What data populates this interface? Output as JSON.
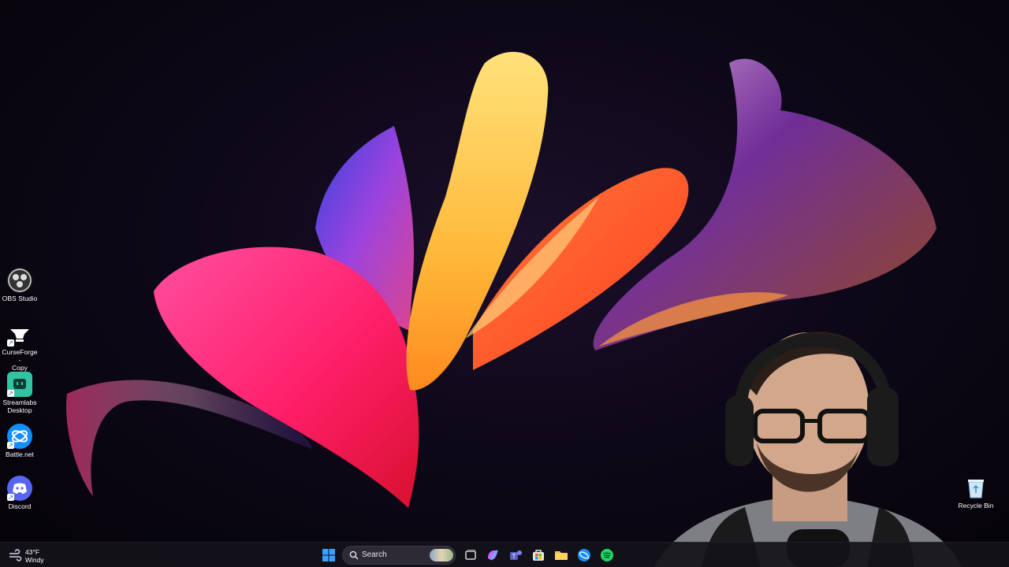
{
  "desktop": {
    "icons": [
      {
        "label_line1": "OBS Studio",
        "label_line2": "",
        "icon": "obs-icon",
        "color": "#2b2b2b"
      },
      {
        "label_line1": "CurseForge -",
        "label_line2": "Copy",
        "icon": "curseforge-icon",
        "color": "#1c1c1c"
      },
      {
        "label_line1": "Streamlabs",
        "label_line2": "Desktop",
        "icon": "streamlabs-icon",
        "color": "#31c3a2"
      },
      {
        "label_line1": "Battle.net",
        "label_line2": "",
        "icon": "battlenet-icon",
        "color": "#148eff"
      },
      {
        "label_line1": "Discord",
        "label_line2": "",
        "icon": "discord-icon",
        "color": "#5865f2"
      }
    ],
    "recycle_bin": {
      "label": "Recycle Bin",
      "icon": "recycle-bin-icon"
    }
  },
  "taskbar": {
    "weather": {
      "temp": "43°F",
      "condition": "Windy",
      "icon": "wind-icon"
    },
    "start_icon": "windows-start-icon",
    "search": {
      "label": "Search",
      "icon": "search-icon"
    },
    "pinned": [
      {
        "name": "task-view-icon",
        "color": "#d9d9d9"
      },
      {
        "name": "copilot-icon",
        "color": "#c46bff"
      },
      {
        "name": "teams-icon",
        "color": "#7b83eb"
      },
      {
        "name": "store-icon",
        "color": "#e8e8e8"
      },
      {
        "name": "file-explorer-icon",
        "color": "#f3c33b"
      },
      {
        "name": "battlenet-taskbar-icon",
        "color": "#148eff"
      },
      {
        "name": "spotify-icon",
        "color": "#1ed760"
      }
    ]
  },
  "overlay": {
    "webcam": "streamer-webcam-feed"
  },
  "colors": {
    "accent": "#0078d4",
    "taskbar_bg": "#14121a"
  }
}
